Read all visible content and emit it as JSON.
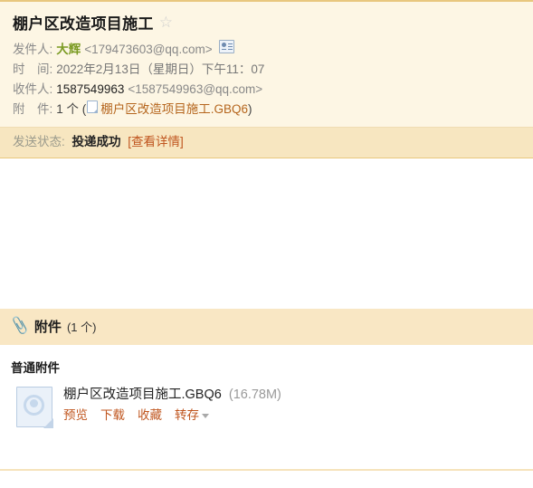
{
  "mail": {
    "subject": "棚户区改造项目施工",
    "star_icon": "star-outline-icon",
    "fields": {
      "sender_label": "发件人:",
      "sender_name": "大辉",
      "sender_email": "<179473603@qq.com>",
      "contact_card_icon": "contact-card-icon",
      "date_label": "时　间:",
      "date_value": "2022年2月13日（星期日）下午11：07",
      "recipient_label": "收件人:",
      "recipient_name": "1587549963",
      "recipient_email": "<1587549963@qq.com>",
      "attachment_label": "附　件:",
      "attachment_count_text": "1 个 (",
      "attachment_inline_icon": "document-icon",
      "attachment_inline_name": "棚户区改造项目施工.GBQ6",
      "attachment_close_paren": ")"
    }
  },
  "send_status": {
    "label": "发送状态:",
    "value": "投递成功",
    "detail_link": "[查看详情]"
  },
  "attachments_panel": {
    "paperclip_icon": "paperclip-icon",
    "title": "附件",
    "count_text": "(1 个)",
    "group_title": "普通附件",
    "items": [
      {
        "file_icon": "generic-file-icon",
        "name": "棚户区改造项目施工.GBQ6",
        "size": "(16.78M)",
        "actions": [
          {
            "label": "预览",
            "name": "preview"
          },
          {
            "label": "下载",
            "name": "download"
          },
          {
            "label": "收藏",
            "name": "favorite"
          }
        ],
        "more_action": {
          "label": "转存",
          "name": "save-to",
          "caret_icon": "chevron-down-icon"
        }
      }
    ]
  },
  "colors": {
    "header_bg": "#fdf6e4",
    "border": "#e8c77e",
    "status_bg": "#f7e6c0",
    "attach_header_bg": "#f9e7c4",
    "link": "#c0561f",
    "sender_name": "#7a9a21"
  }
}
